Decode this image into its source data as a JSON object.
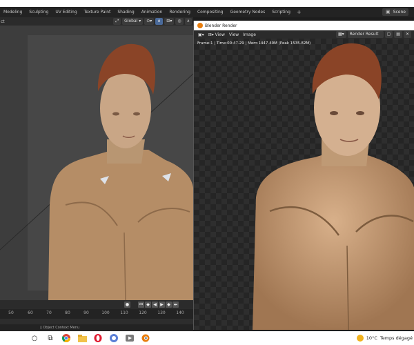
{
  "workspace_tabs": [
    "Modeling",
    "Sculpting",
    "UV Editing",
    "Texture Paint",
    "Shading",
    "Animation",
    "Rendering",
    "Compositing",
    "Geometry Nodes",
    "Scripting"
  ],
  "workspace_add": "+",
  "scene_name": "Scene",
  "viewport": {
    "object_label": "ct",
    "transform": "Global"
  },
  "timeline": {
    "ticks": [
      "50",
      "60",
      "70",
      "80",
      "90",
      "100",
      "110",
      "120",
      "130",
      "140"
    ],
    "status_text": "Object Context Menu"
  },
  "render_window": {
    "title": "Blender Render",
    "menu_view": "View",
    "menu_view2": "View",
    "menu_image": "Image",
    "result_label": "Render Result",
    "info": "Frame:1 | Time:00:47.29 | Mem:1447.40M (Peak 1535.82M)"
  },
  "taskbar": {
    "temperature": "10°C",
    "weather": "Temps dégagé"
  },
  "colors": {
    "blender_orange": "#e87d0d",
    "skin": "#c9a07a",
    "hair": "#8a4427"
  }
}
